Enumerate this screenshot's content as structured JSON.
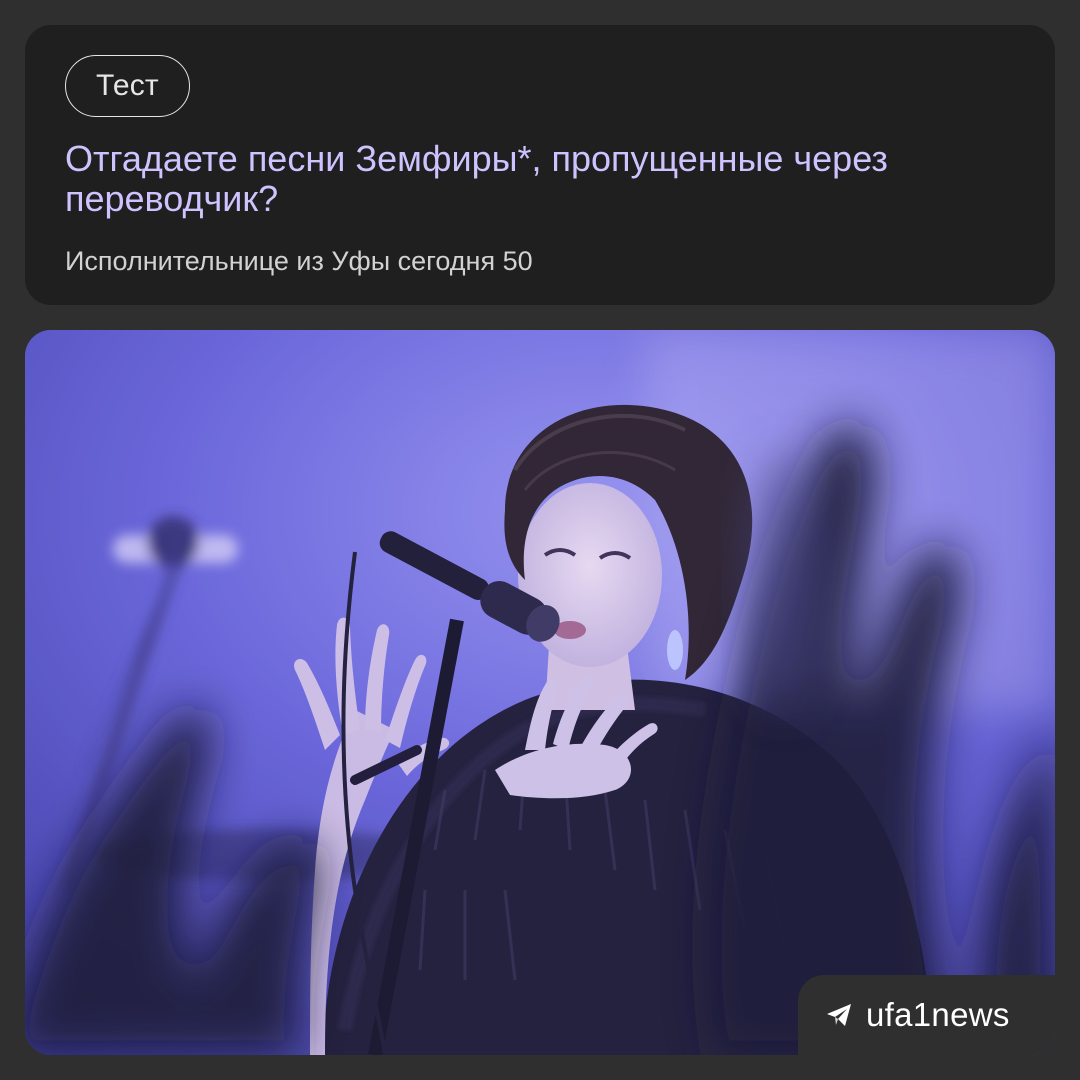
{
  "card": {
    "tag": "Тест",
    "headline": "Отгадаете песни Земфиры*, пропущенные через переводчик?",
    "subtitle": "Исполнительнице из Уфы сегодня 50"
  },
  "photo": {
    "subject": "singer-with-microphone-on-stage",
    "accent_color": "#6a6ad8"
  },
  "brand": {
    "icon": "telegram-icon",
    "name": "ufa1news"
  },
  "colors": {
    "background": "#2f2f2f",
    "card": "#1f1f1f",
    "headline": "#cfc3ff",
    "text": "#d2d2d2"
  }
}
